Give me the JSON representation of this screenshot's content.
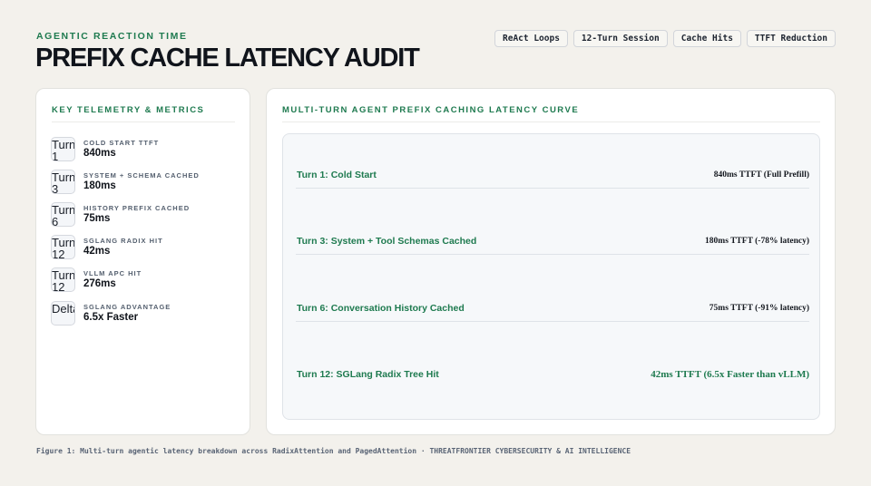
{
  "header": {
    "eyebrow": "AGENTIC REACTION TIME",
    "title": "PREFIX CACHE LATENCY AUDIT",
    "tags": [
      "ReAct Loops",
      "12-Turn Session",
      "Cache Hits",
      "TTFT Reduction"
    ]
  },
  "metrics_panel": {
    "title": "KEY TELEMETRY & METRICS",
    "items": [
      {
        "icon": "Turn 1",
        "label": "COLD START TTFT",
        "value": "840ms"
      },
      {
        "icon": "Turn 3",
        "label": "SYSTEM + SCHEMA CACHED",
        "value": "180ms"
      },
      {
        "icon": "Turn 6",
        "label": "HISTORY PREFIX CACHED",
        "value": "75ms"
      },
      {
        "icon": "Turn 12",
        "label": "SGLANG RADIX HIT",
        "value": "42ms"
      },
      {
        "icon": "Turn 12",
        "label": "VLLM APC HIT",
        "value": "276ms"
      },
      {
        "icon": "Delta",
        "label": "SGLANG ADVANTAGE",
        "value": "6.5x Faster"
      }
    ]
  },
  "curve_panel": {
    "title": "MULTI-TURN AGENT PREFIX CACHING LATENCY CURVE",
    "rows": [
      {
        "label": "Turn 1: Cold Start",
        "value": "840ms TTFT (Full Prefill)"
      },
      {
        "label": "Turn 3: System + Tool Schemas Cached",
        "value": "180ms TTFT (-78% latency)"
      },
      {
        "label": "Turn 6: Conversation History Cached",
        "value": "75ms TTFT (-91% latency)"
      },
      {
        "label": "Turn 12: SGLang Radix Tree Hit",
        "value": "42ms TTFT (6.5x Faster than vLLM)"
      }
    ]
  },
  "caption": "Figure 1: Multi-turn agentic latency breakdown across RadixAttention and PagedAttention · THREATFRONTIER CYBERSECURITY & AI INTELLIGENCE",
  "colors": {
    "accent": "#1e7a4f",
    "background": "#f3f1ec",
    "card": "#ffffff"
  }
}
